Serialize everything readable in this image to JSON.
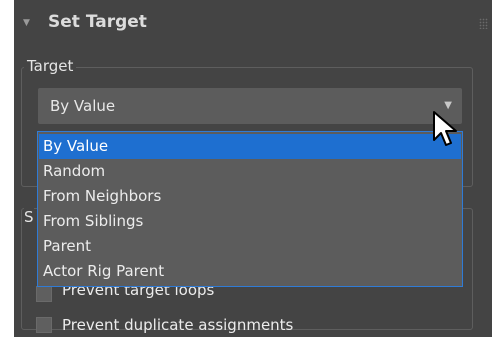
{
  "rollout": {
    "title": "Set Target",
    "collapse_icon": "triangle-down-icon",
    "grip_icon": "grip-dots-icon"
  },
  "target_group": {
    "label": "Target",
    "select": {
      "value": "By Value",
      "arrow_icon": "chevron-down-icon"
    },
    "options": [
      {
        "label": "By Value",
        "selected": true
      },
      {
        "label": "Random",
        "selected": false
      },
      {
        "label": "From Neighbors",
        "selected": false
      },
      {
        "label": "From Siblings",
        "selected": false
      },
      {
        "label": "Parent",
        "selected": false
      },
      {
        "label": "Actor Rig Parent",
        "selected": false
      }
    ]
  },
  "second_group": {
    "label_fragment": "S"
  },
  "checkboxes": {
    "prevent_loops": {
      "label": "Prevent target loops",
      "checked": false
    },
    "prevent_duplicates": {
      "label": "Prevent duplicate assignments",
      "checked": false
    }
  },
  "colors": {
    "panel_bg": "#444444",
    "control_bg": "#5c5c5c",
    "selection": "#1e6fd0",
    "list_border": "#2f7bd6",
    "text": "#ececec"
  },
  "cursor_icon": "mouse-pointer-icon"
}
